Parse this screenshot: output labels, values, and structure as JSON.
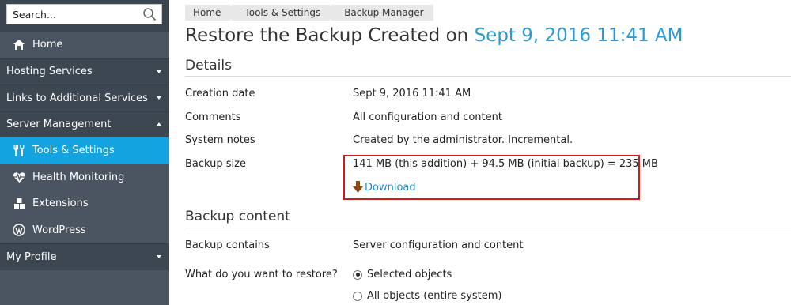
{
  "search": {
    "placeholder": "Search..."
  },
  "sidebar": {
    "home": "Home",
    "sections": [
      {
        "label": "Hosting Services",
        "expanded": false
      },
      {
        "label": "Links to Additional Services",
        "expanded": false
      },
      {
        "label": "Server Management",
        "expanded": true
      }
    ],
    "server_items": [
      {
        "label": "Tools & Settings",
        "icon": "tools-icon",
        "active": true
      },
      {
        "label": "Health Monitoring",
        "icon": "heart-pulse-icon"
      },
      {
        "label": "Extensions",
        "icon": "extensions-icon"
      },
      {
        "label": "WordPress",
        "icon": "wordpress-icon"
      }
    ],
    "my_profile": "My Profile",
    "active_color": "#12a3e0"
  },
  "breadcrumb": [
    "Home",
    "Tools & Settings",
    "Backup Manager"
  ],
  "title": {
    "prefix": "Restore the Backup Created on",
    "date": "Sept 9, 2016 11:41 AM"
  },
  "details": {
    "heading": "Details",
    "rows": [
      {
        "label": "Creation date",
        "value": "Sept 9, 2016 11:41 AM"
      },
      {
        "label": "Comments",
        "value": "All configuration and content"
      },
      {
        "label": "System notes",
        "value": "Created by the administrator. Incremental."
      },
      {
        "label": "Backup size",
        "value": "141 MB (this addition) + 94.5 MB (initial backup) = 235 MB"
      }
    ],
    "download_label": "Download"
  },
  "backup_content": {
    "heading": "Backup content",
    "contains_label": "Backup contains",
    "contains_value": "Server configuration and content",
    "restore_label": "What do you want to restore?",
    "options": [
      {
        "label": "Selected objects",
        "checked": true
      },
      {
        "label": "All objects (entire system)",
        "checked": false
      }
    ]
  }
}
